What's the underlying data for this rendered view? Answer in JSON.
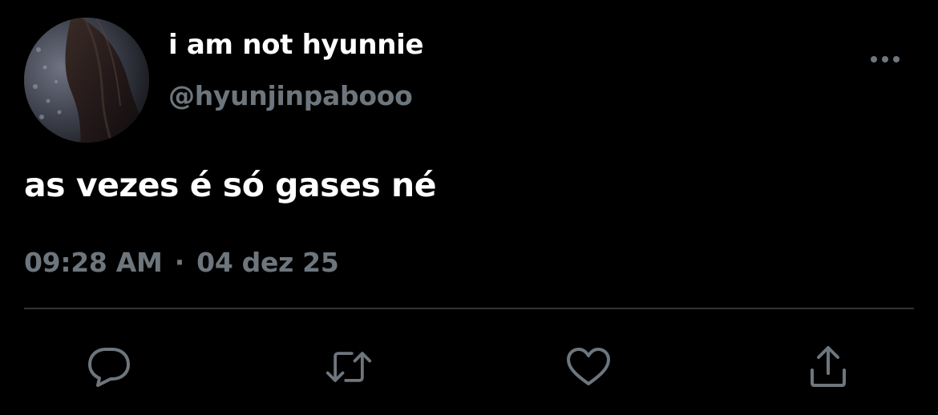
{
  "tweet": {
    "author": {
      "display_name": "i am not hyunnie",
      "handle": "@hyunjinpabooo"
    },
    "text": "as vezes é só gases né",
    "time": "09:28 AM",
    "separator": "·",
    "date": "04 dez 25"
  },
  "actions": {
    "reply": "reply-icon",
    "retweet": "retweet-icon",
    "like": "heart-icon",
    "share": "share-icon"
  },
  "colors": {
    "background": "#000000",
    "primary_text": "#ffffff",
    "secondary_text": "#6e767d",
    "divider": "#2f3336"
  }
}
